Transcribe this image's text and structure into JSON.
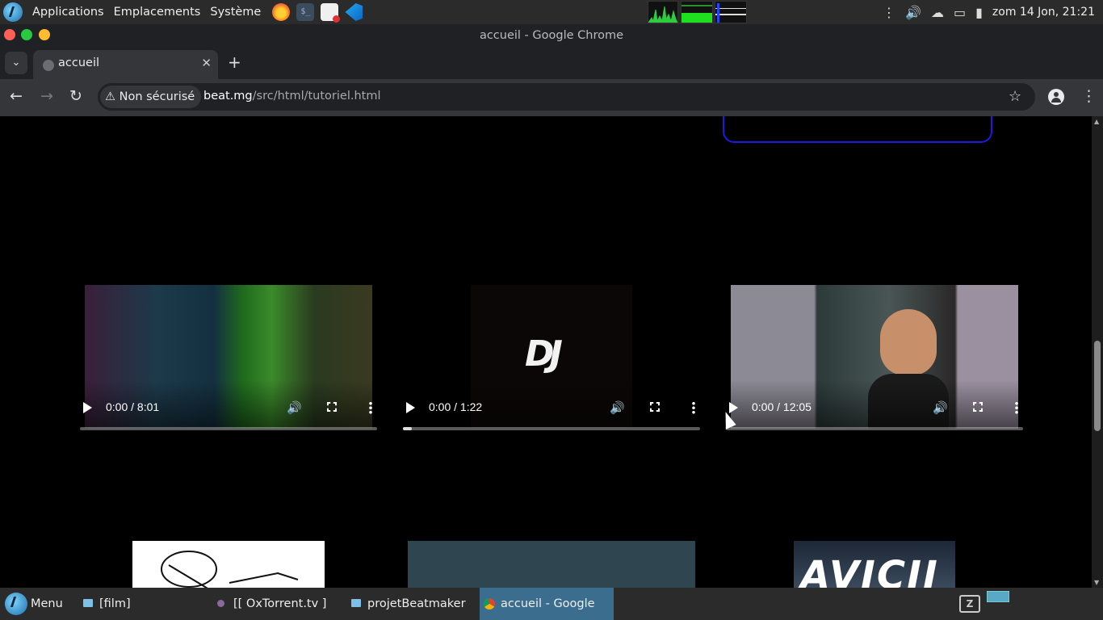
{
  "top_panel": {
    "menu": [
      "Applications",
      "Emplacements",
      "Système"
    ],
    "clock": "zom 14 Jon, 21:21"
  },
  "window": {
    "title": "accueil - Google Chrome"
  },
  "browser": {
    "tab_title": "accueil",
    "security_label": "Non sécurisé",
    "url_host": "beat.mg",
    "url_path": "/src/html/tutoriel.html"
  },
  "videos": [
    {
      "time": "0:00 / 8:01",
      "progress": 0
    },
    {
      "time": "0:00 / 1:22",
      "progress": 0.03
    },
    {
      "time": "0:00 / 12:05",
      "progress": 0
    }
  ],
  "thumbnails": {
    "avicii_text": "AVICII",
    "dj_logo_text": "DJ"
  },
  "taskbar": {
    "menu_label": "Menu",
    "items": [
      "[film]",
      "[[ OxTorrent.tv ] Z…",
      "projetBeatmaker",
      "accueil - Google C…"
    ]
  }
}
